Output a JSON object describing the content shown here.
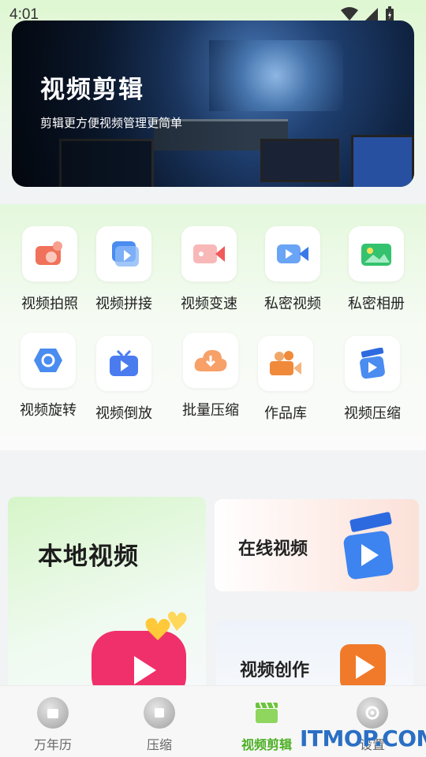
{
  "status_bar": {
    "time": "4:01"
  },
  "banner": {
    "title": "视频剪辑",
    "subtitle": "剪辑更方便视频管理更简单"
  },
  "tools": [
    {
      "label": "视频拍照",
      "icon": "camera-icon",
      "color": "#f0725a"
    },
    {
      "label": "视频拼接",
      "icon": "video-join-icon",
      "color": "#4a8cf0"
    },
    {
      "label": "视频变速",
      "icon": "video-speed-icon",
      "color": "#f05a5a"
    },
    {
      "label": "私密视频",
      "icon": "private-video-icon",
      "color": "#4a8cf0"
    },
    {
      "label": "私密相册",
      "icon": "private-album-icon",
      "color": "#34c26e"
    },
    {
      "label": "视频旋转",
      "icon": "video-rotate-icon",
      "color": "#4a8cf0"
    },
    {
      "label": "视频倒放",
      "icon": "video-reverse-icon",
      "color": "#4a7cf0"
    },
    {
      "label": "批量压缩",
      "icon": "batch-compress-icon",
      "color": "#f0823a"
    },
    {
      "label": "作品库",
      "icon": "works-library-icon",
      "color": "#f08a3a"
    },
    {
      "label": "视频压缩",
      "icon": "video-compress-icon",
      "color": "#4a8cf0"
    }
  ],
  "cards": {
    "local": "本地视频",
    "online": "在线视频",
    "create": "视频创作"
  },
  "nav": [
    {
      "label": "万年历",
      "icon": "calendar-icon"
    },
    {
      "label": "压缩",
      "icon": "compress-icon"
    },
    {
      "label": "视频剪辑",
      "icon": "video-edit-icon"
    },
    {
      "label": "设置",
      "icon": "settings-icon"
    }
  ],
  "watermark": "ITMOP.COM",
  "colors": {
    "accent_green": "#4caf24",
    "watermark_blue": "#2a6fc4"
  }
}
